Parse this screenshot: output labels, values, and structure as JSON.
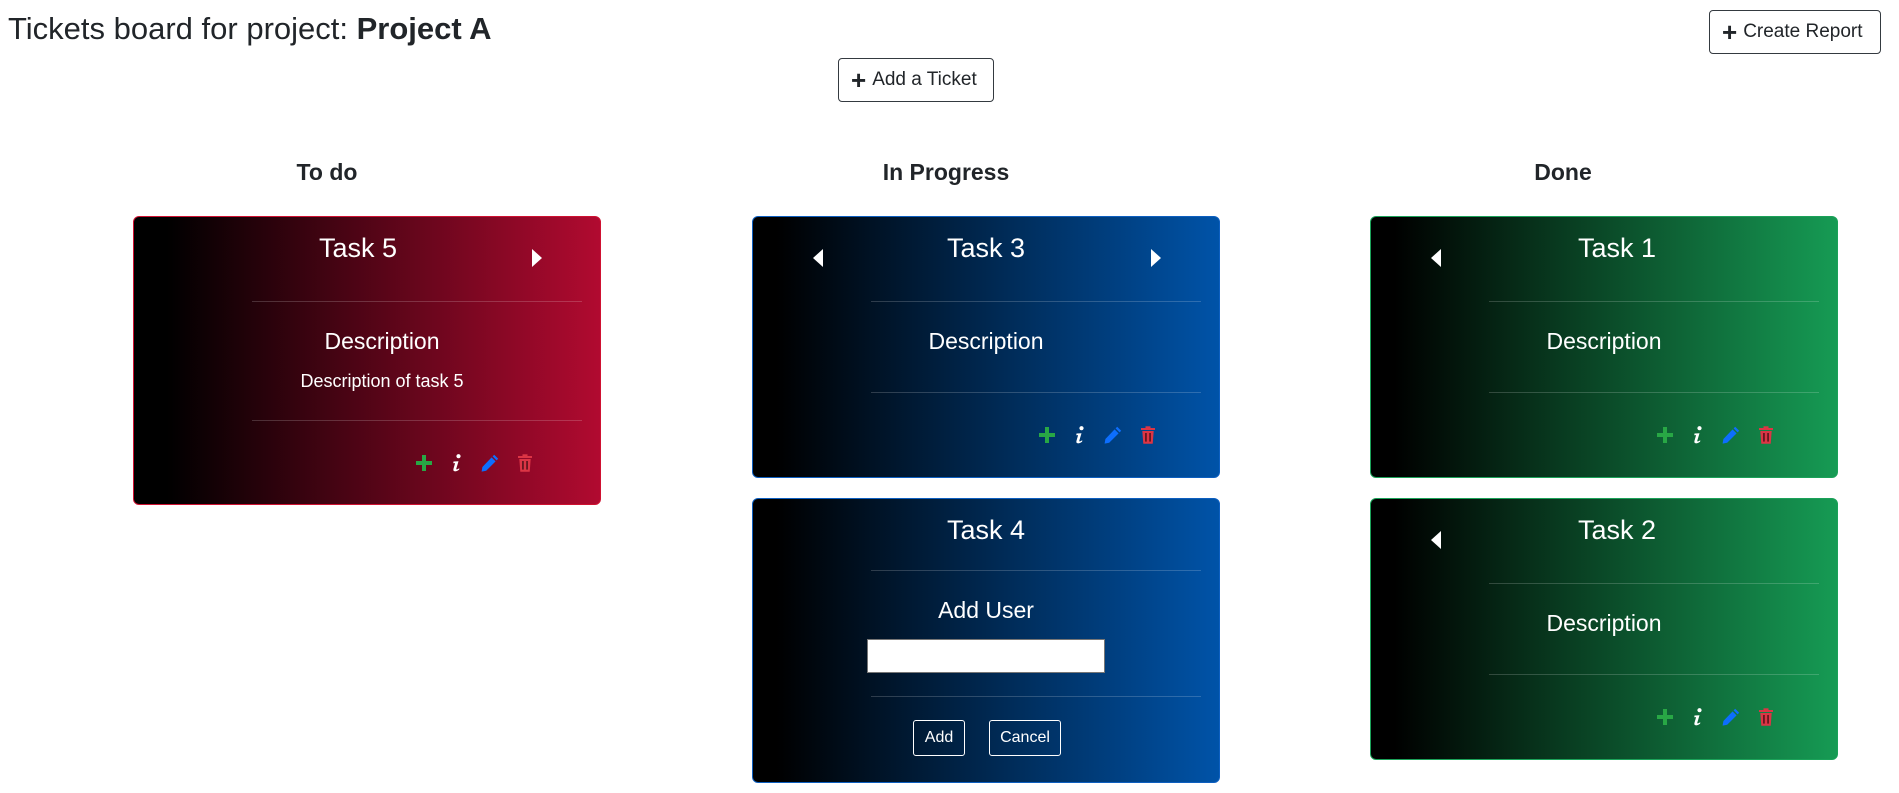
{
  "header": {
    "title_prefix": "Tickets board for project: ",
    "project_name": "Project A",
    "create_report_label": "Create Report",
    "add_ticket_label": "Add a Ticket"
  },
  "columns": {
    "todo": "To do",
    "in_progress": "In Progress",
    "done": "Done"
  },
  "cards": {
    "task5": {
      "title": "Task 5",
      "description_heading": "Description",
      "description": "Description of task 5"
    },
    "task3": {
      "title": "Task 3",
      "description_heading": "Description"
    },
    "task4": {
      "title": "Task 4",
      "add_user_heading": "Add User",
      "input_value": "",
      "add_label": "Add",
      "cancel_label": "Cancel"
    },
    "task1": {
      "title": "Task 1",
      "description_heading": "Description"
    },
    "task2": {
      "title": "Task 2",
      "description_heading": "Description"
    }
  },
  "icons": {
    "add_user": "plus-icon",
    "info": "info-icon",
    "edit": "pencil-icon",
    "delete": "trash-icon",
    "move_left": "caret-left-icon",
    "move_right": "caret-right-icon"
  },
  "colors": {
    "todo_accent": "#b10a30",
    "in_progress_accent": "#0053a8",
    "done_accent": "#169b54",
    "icon_green": "#28a745",
    "icon_blue": "#0d6efd",
    "icon_red": "#dc3545"
  }
}
